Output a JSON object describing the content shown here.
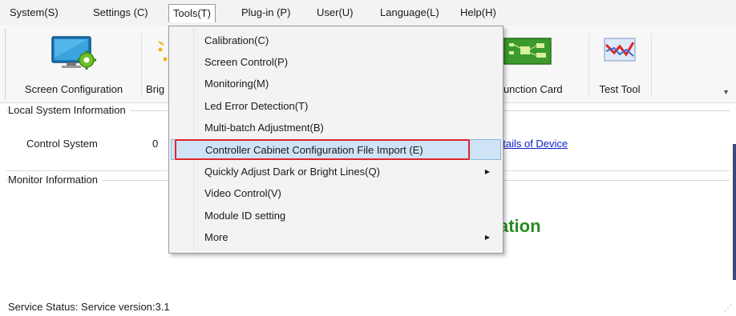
{
  "menubar": {
    "items": [
      "System(S)",
      "Settings (C)",
      "Tools(T)",
      "Plug-in (P)",
      "User(U)",
      "Language(L)",
      "Help(H)"
    ],
    "active": "Tools(T)"
  },
  "toolbar": {
    "screen_configuration": "Screen Configuration",
    "brightness_partial": "Brig",
    "multifunction_card_partial": "-function Card",
    "test_tool": "Test Tool"
  },
  "local_info": {
    "title": "Local System Information",
    "control_system_label": "Control System",
    "control_system_value": "0",
    "details_link": "etails of Device"
  },
  "monitor": {
    "title": "Monitor Information",
    "partial_heading": "ation"
  },
  "status": {
    "text": "Service Status:  Service version:3.1"
  },
  "tools_menu": {
    "items": [
      {
        "label": "Calibration(C)",
        "submenu": false
      },
      {
        "label": "Screen Control(P)",
        "submenu": false
      },
      {
        "label": "Monitoring(M)",
        "submenu": false
      },
      {
        "label": "Led Error Detection(T)",
        "submenu": false
      },
      {
        "label": "Multi-batch Adjustment(B)",
        "submenu": false
      },
      {
        "label": "Controller Cabinet Configuration File Import (E)",
        "submenu": false,
        "highlighted": true
      },
      {
        "label": "Quickly Adjust Dark or Bright Lines(Q)",
        "submenu": true
      },
      {
        "label": "Video Control(V)",
        "submenu": false
      },
      {
        "label": "Module ID setting",
        "submenu": false
      },
      {
        "label": "More",
        "submenu": true
      }
    ]
  },
  "colors": {
    "highlight_fill": "#cfe3f6",
    "highlight_frame": "#e0242a",
    "link": "#0b1fc7",
    "green_heading": "#2b8a23"
  }
}
